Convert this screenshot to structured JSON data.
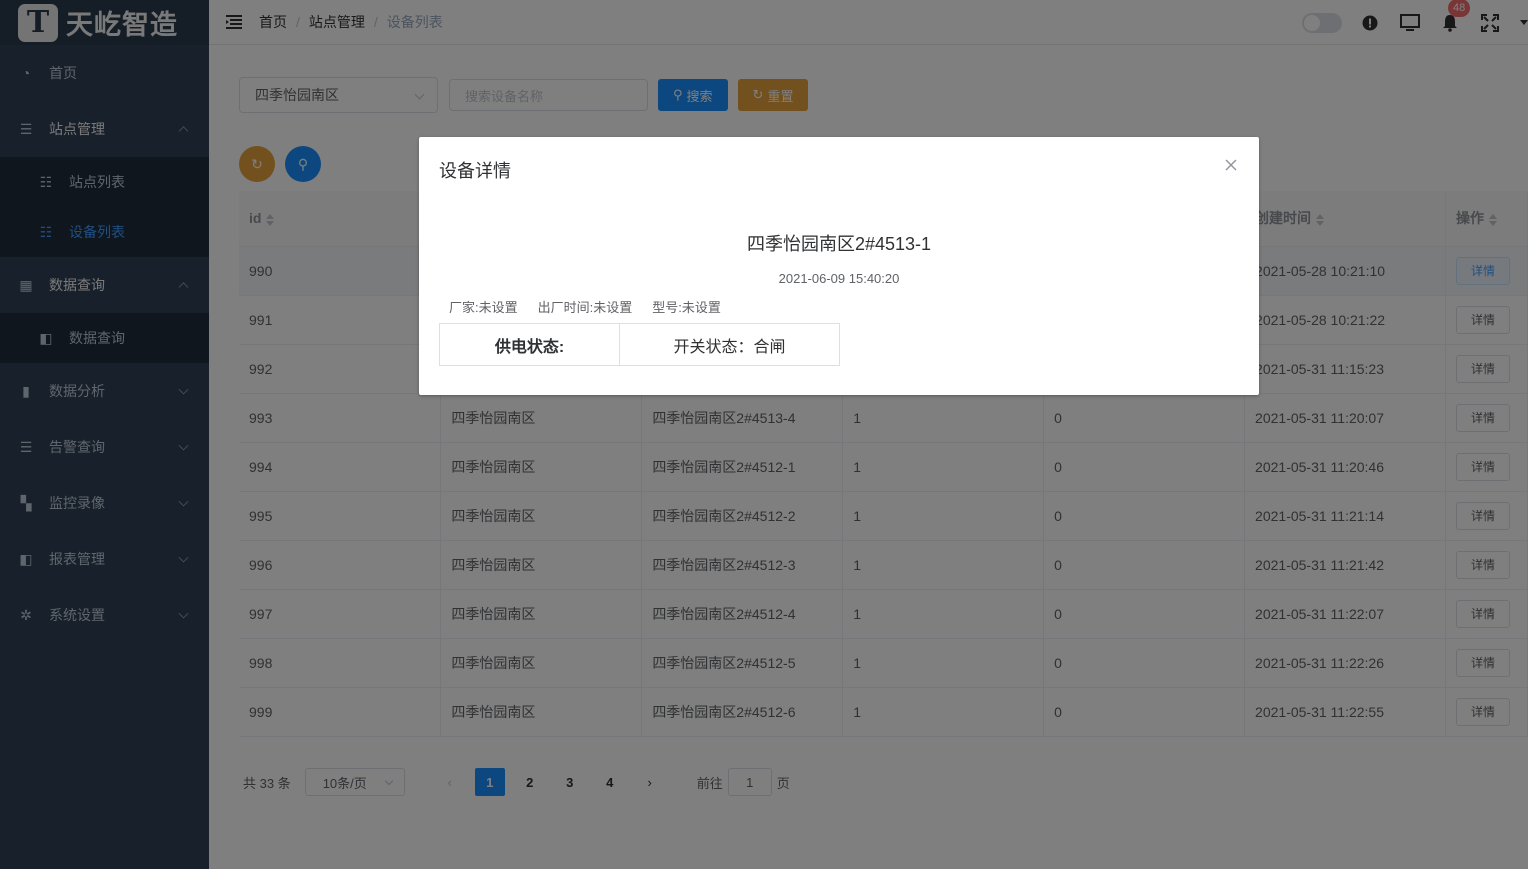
{
  "logo": {
    "mark": "T",
    "text": "天屹智造"
  },
  "sidebar": {
    "items": [
      {
        "label": "首页",
        "icon": "dashboard-icon",
        "glyph": "◔"
      },
      {
        "label": "站点管理",
        "icon": "list-icon",
        "glyph": "☰",
        "open": true,
        "children": [
          {
            "label": "站点列表",
            "icon": "tree-table-icon",
            "glyph": "☷"
          },
          {
            "label": "设备列表",
            "icon": "tree-list-icon",
            "glyph": "☷",
            "active": true
          }
        ]
      },
      {
        "label": "数据查询",
        "icon": "table-icon",
        "glyph": "▦",
        "open": true,
        "children": [
          {
            "label": "数据查询",
            "icon": "book-icon",
            "glyph": "◧"
          }
        ]
      },
      {
        "label": "数据分析",
        "icon": "chart-icon",
        "glyph": "▮"
      },
      {
        "label": "告警查询",
        "icon": "list-check-icon",
        "glyph": "☰"
      },
      {
        "label": "监控录像",
        "icon": "grid-icon",
        "glyph": "▚"
      },
      {
        "label": "报表管理",
        "icon": "report-icon",
        "glyph": "◧"
      },
      {
        "label": "系统设置",
        "icon": "settings-icon",
        "glyph": "✲"
      }
    ]
  },
  "breadcrumb": [
    "首页",
    "站点管理",
    "设备列表"
  ],
  "navbar": {
    "notifications": "48"
  },
  "filter": {
    "site_selected": "四季怡园南区",
    "search_placeholder": "搜索设备名称",
    "search_label": "搜索",
    "reset_label": "重置"
  },
  "table": {
    "headers": [
      "id",
      "",
      "",
      "",
      "",
      "创建时间",
      "操作"
    ],
    "rows": [
      [
        "990",
        "",
        "",
        "",
        "",
        "2021-05-28 10:21:10"
      ],
      [
        "991",
        "",
        "",
        "",
        "",
        "2021-05-28 10:21:22"
      ],
      [
        "992",
        "",
        "",
        "",
        "",
        "2021-05-31 11:15:23"
      ],
      [
        "993",
        "四季怡园南区",
        "四季怡园南区2#4513-4",
        "1",
        "0",
        "2021-05-31 11:20:07"
      ],
      [
        "994",
        "四季怡园南区",
        "四季怡园南区2#4512-1",
        "1",
        "0",
        "2021-05-31 11:20:46"
      ],
      [
        "995",
        "四季怡园南区",
        "四季怡园南区2#4512-2",
        "1",
        "0",
        "2021-05-31 11:21:14"
      ],
      [
        "996",
        "四季怡园南区",
        "四季怡园南区2#4512-3",
        "1",
        "0",
        "2021-05-31 11:21:42"
      ],
      [
        "997",
        "四季怡园南区",
        "四季怡园南区2#4512-4",
        "1",
        "0",
        "2021-05-31 11:22:07"
      ],
      [
        "998",
        "四季怡园南区",
        "四季怡园南区2#4512-5",
        "1",
        "0",
        "2021-05-31 11:22:26"
      ],
      [
        "999",
        "四季怡园南区",
        "四季怡园南区2#4512-6",
        "1",
        "0",
        "2021-05-31 11:22:55"
      ]
    ],
    "action_label": "详情"
  },
  "pagination": {
    "total": "共 33 条",
    "page_size": "10条/页",
    "pages": [
      "1",
      "2",
      "3",
      "4"
    ],
    "current": "1",
    "goto_prefix": "前往",
    "goto_value": "1",
    "goto_suffix": "页"
  },
  "dialog": {
    "title": "设备详情",
    "device_name": "四季怡园南区2#4513-1",
    "timestamp": "2021-06-09 15:40:20",
    "meta": [
      "厂家:未设置",
      "出厂时间:未设置",
      "型号:未设置"
    ],
    "status_label": "供电状态:",
    "status_value": "开关状态：合闸"
  },
  "colors": {
    "sidebar_bg": "#304156",
    "primary": "#1890ff",
    "warning": "#e6a23c",
    "active_menu": "#409eff",
    "badge": "#f56c6c"
  }
}
